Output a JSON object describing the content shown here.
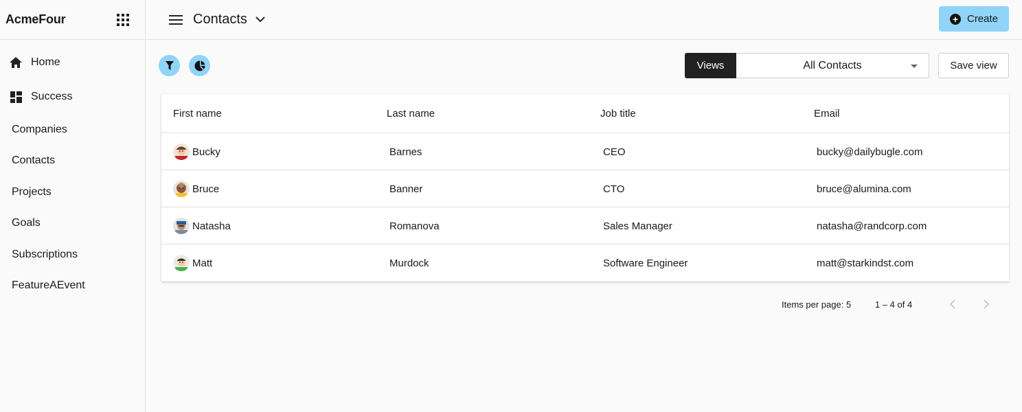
{
  "app": {
    "brand": "AcmeFour",
    "apps_icon": "grid-apps-icon"
  },
  "sidebar": {
    "items": [
      {
        "label": "Home",
        "icon": "home-icon"
      },
      {
        "label": "Success",
        "icon": "dashboard-icon"
      },
      {
        "label": "Companies"
      },
      {
        "label": "Contacts"
      },
      {
        "label": "Projects"
      },
      {
        "label": "Goals"
      },
      {
        "label": "Subscriptions"
      },
      {
        "label": "FeatureAEvent"
      }
    ]
  },
  "header": {
    "title": "Contacts",
    "create_label": "Create",
    "accent_color": "#90d4f7"
  },
  "toolbar": {
    "filter_icon": "filter-icon",
    "chart_icon": "pie-chart-icon",
    "views_label": "Views",
    "selected_view": "All Contacts",
    "save_view_label": "Save view"
  },
  "table": {
    "columns": [
      "First name",
      "Last name",
      "Job title",
      "Email"
    ],
    "rows": [
      {
        "first": "Bucky",
        "last": "Barnes",
        "title": "CEO",
        "email": "bucky@dailybugle.com"
      },
      {
        "first": "Bruce",
        "last": "Banner",
        "title": "CTO",
        "email": "bruce@alumina.com"
      },
      {
        "first": "Natasha",
        "last": "Romanova",
        "title": "Sales Manager",
        "email": "natasha@randcorp.com"
      },
      {
        "first": "Matt",
        "last": "Murdock",
        "title": "Software Engineer",
        "email": "matt@starkindst.com"
      }
    ]
  },
  "pagination": {
    "items_per_page": "Items per page: 5",
    "range": "1 – 4 of 4"
  }
}
